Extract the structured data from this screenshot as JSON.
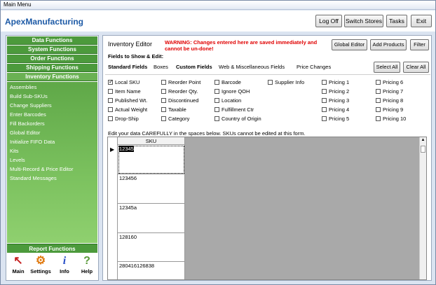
{
  "window": {
    "title": "Main Menu"
  },
  "header": {
    "app_name": "ApexManufacturing",
    "buttons": {
      "logoff": "Log Off",
      "switch": "Switch Stores",
      "tasks": "Tasks",
      "exit": "Exit"
    }
  },
  "sidebar": {
    "sections": [
      "Data Functions",
      "System Functions",
      "Order Functions",
      "Shipping Functions",
      "Inventory Functions"
    ],
    "items": [
      "Assemblies",
      "Build Sub-SKUs",
      "Change Suppliers",
      "Enter Barcodes",
      "Fill Backorders",
      "Global Editor",
      "Initialize FIFO Data",
      "Kits",
      "Levels",
      "Multi-Record & Price Editor",
      "Standard Messages"
    ],
    "report": "Report Functions"
  },
  "bottom": {
    "main": "Main",
    "settings": "Settings",
    "info": "Info",
    "help": "Help"
  },
  "editor": {
    "title": "Inventory Editor",
    "warning_line1": "WARNING: Changes entered here are saved immediately and",
    "warning_line2": "cannot be un-done!",
    "buttons": {
      "global": "Global Editor",
      "add": "Add Products",
      "filter": "Filter",
      "select_all": "Select All",
      "clear_all": "Clear All"
    },
    "fields_label": "Fields to Show & Edit:",
    "tabs": [
      "Standard Fields",
      "Boxes",
      "Custom Fields",
      "Web & Miscellaneous Fields",
      "Price Changes"
    ],
    "instructions": "Edit your data CAREFULLY in the spaces below.  SKUs cannot be edited at this form."
  },
  "checkboxes": {
    "c1": [
      {
        "label": "Local SKU",
        "checked": true
      },
      {
        "label": "Item Name",
        "checked": false
      },
      {
        "label": "Published Wt.",
        "checked": false
      },
      {
        "label": "Actual Weight",
        "checked": false
      },
      {
        "label": "Drop-Ship",
        "checked": false
      }
    ],
    "c2": [
      {
        "label": "Reorder Point",
        "checked": false
      },
      {
        "label": "Reorder Qty.",
        "checked": false
      },
      {
        "label": "Discontinued",
        "checked": false
      },
      {
        "label": "Taxable",
        "checked": false
      },
      {
        "label": "Category",
        "checked": false
      }
    ],
    "c3": [
      {
        "label": "Barcode",
        "checked": false
      },
      {
        "label": "Ignore QOH",
        "checked": false
      },
      {
        "label": "Location",
        "checked": false
      },
      {
        "label": "Fulfillment Ctr",
        "checked": false
      },
      {
        "label": "Country of Origin",
        "checked": false
      }
    ],
    "c4": [
      {
        "label": "Supplier Info",
        "checked": false
      }
    ],
    "c5": [
      {
        "label": "Pricing 1",
        "checked": false
      },
      {
        "label": "Pricing 2",
        "checked": false
      },
      {
        "label": "Pricing 3",
        "checked": false
      },
      {
        "label": "Pricing 4",
        "checked": false
      },
      {
        "label": "Pricing 5",
        "checked": false
      }
    ],
    "c6": [
      {
        "label": "Pricing 6",
        "checked": false
      },
      {
        "label": "Pricing 7",
        "checked": false
      },
      {
        "label": "Pricing 8",
        "checked": false
      },
      {
        "label": "Pricing 9",
        "checked": false
      },
      {
        "label": "Pricing 10",
        "checked": false
      }
    ]
  },
  "grid": {
    "column": "SKU",
    "rows": [
      "12345",
      "123456",
      "12345a",
      "128160",
      "280416126838"
    ]
  },
  "colors": {
    "accent": "#1d5aa6",
    "warning": "#e00000",
    "nav_green": "#4c9a3c"
  }
}
